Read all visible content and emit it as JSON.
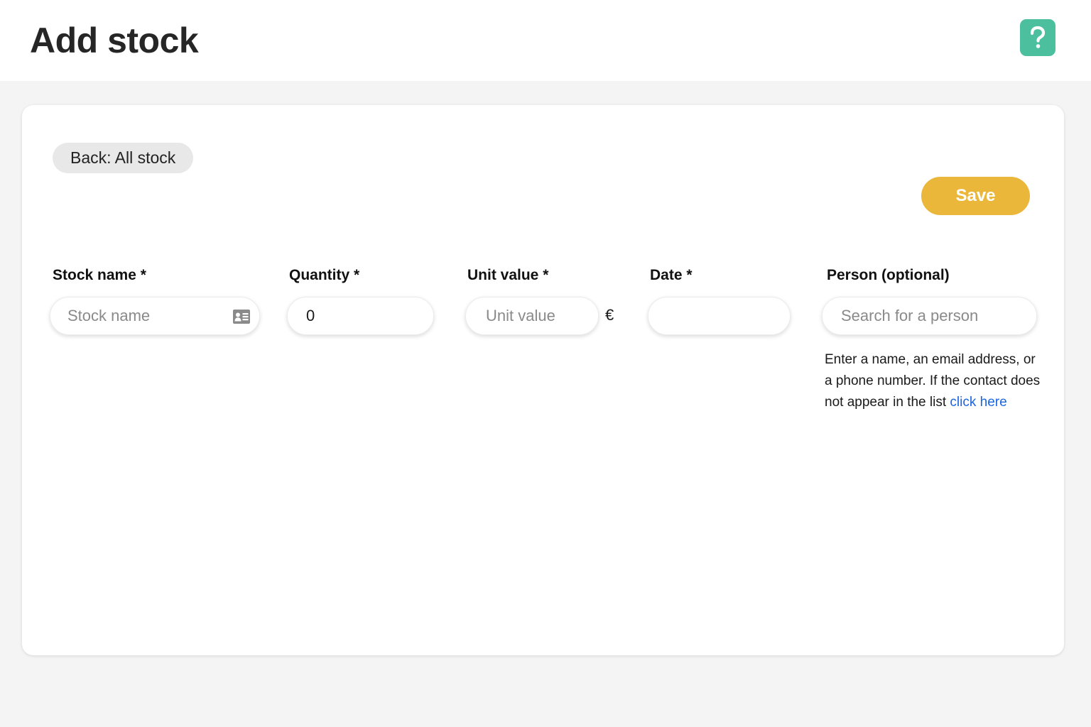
{
  "header": {
    "title": "Add stock",
    "help_label": "?"
  },
  "toolbar": {
    "back_label": "Back: All stock",
    "save_label": "Save"
  },
  "form": {
    "stock_name": {
      "label": "Stock name *",
      "placeholder": "Stock name",
      "value": "",
      "icon": "contact-card-icon"
    },
    "quantity": {
      "label": "Quantity *",
      "value": "0"
    },
    "unit_value": {
      "label": "Unit value *",
      "placeholder": "Unit value",
      "value": "",
      "currency": "€"
    },
    "date": {
      "label": "Date *",
      "value": ""
    },
    "person": {
      "label": "Person (optional)",
      "placeholder": "Search for a person",
      "value": "",
      "helper_text": "Enter a name, an email address, or a phone number. If the contact does not appear in the list",
      "helper_link": "click here"
    }
  },
  "colors": {
    "help_button": "#4bbf9e",
    "save_button": "#ebb73a",
    "link": "#1a66e0",
    "page_background": "#f4f4f4"
  }
}
